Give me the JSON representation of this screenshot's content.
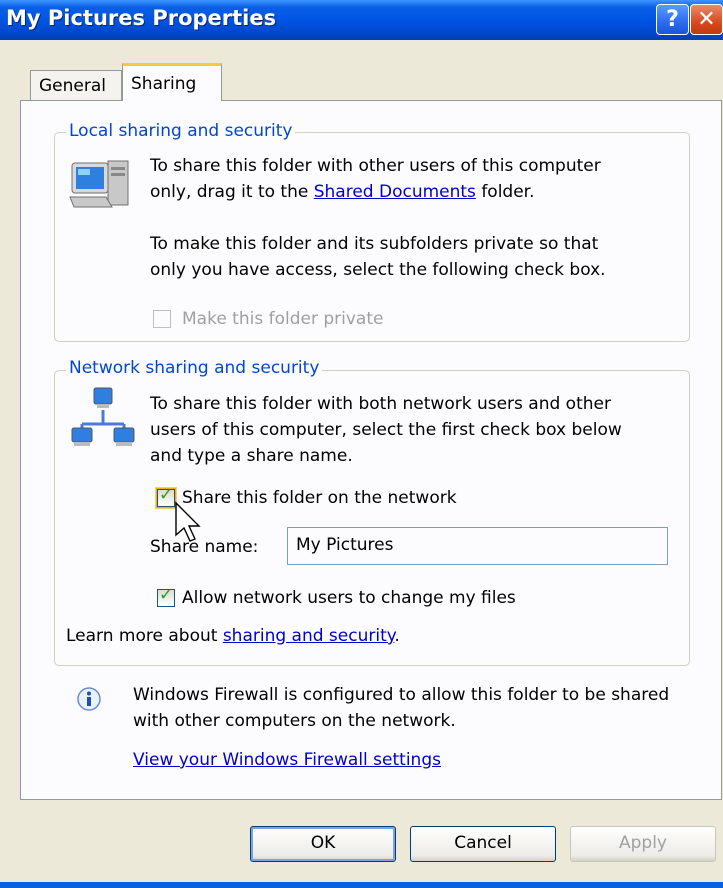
{
  "window": {
    "title": "My Pictures Properties",
    "help_label": "?",
    "close_label": "✕"
  },
  "tabs": [
    {
      "label": "General",
      "selected": false
    },
    {
      "label": "Sharing",
      "selected": true
    }
  ],
  "local": {
    "legend": "Local sharing and security",
    "line1": "To share this folder with other users of this computer",
    "line2_pre": "only, drag it to the ",
    "line2_link": "Shared Documents",
    "line2_post": " folder.",
    "line3": "To make this folder and its subfolders private so that",
    "line4": "only you have access, select the following check box.",
    "private_label": "Make this folder private",
    "private_checked": false
  },
  "network": {
    "legend": "Network sharing and security",
    "line1": "To share this folder with both network users and other",
    "line2": "users of this computer, select the first check box below",
    "line3": "and type a share name.",
    "share_label": "Share this folder on the network",
    "share_checked": true,
    "share_name_label": "Share name:",
    "share_name_value": "My Pictures",
    "allow_label": "Allow network users to change my files",
    "allow_checked": true,
    "learn_pre": "Learn more about ",
    "learn_link": "sharing and security",
    "learn_post": "."
  },
  "firewall": {
    "line1": "Windows Firewall is configured to allow this folder to be shared",
    "line2": "with other computers on the network.",
    "link": "View your Windows Firewall settings"
  },
  "buttons": {
    "ok": "OK",
    "cancel": "Cancel",
    "apply": "Apply"
  }
}
